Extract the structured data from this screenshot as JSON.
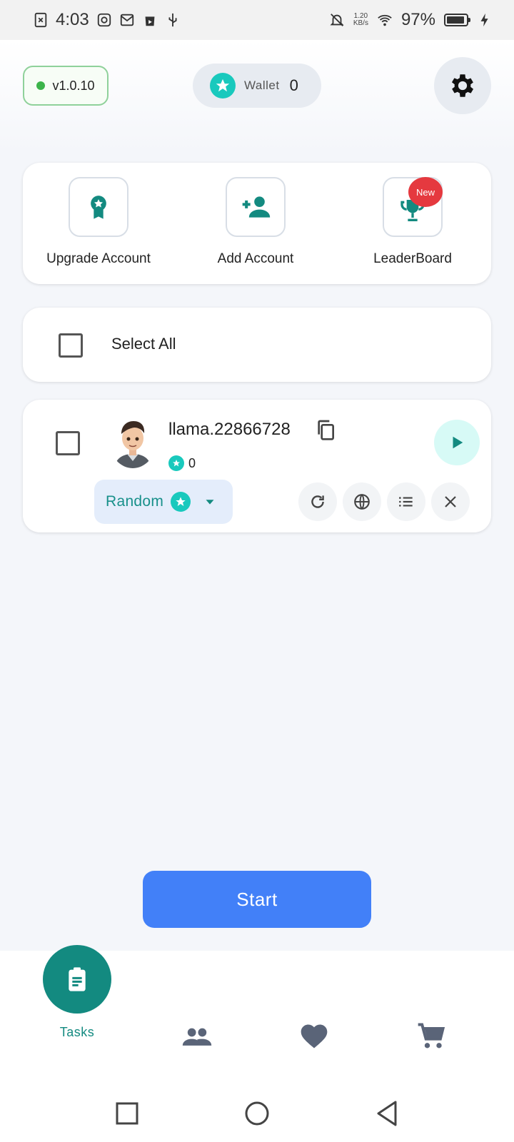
{
  "status_bar": {
    "time": "4:03",
    "net_speed_top": "1.20",
    "net_speed_bottom": "KB/s",
    "battery": "97%"
  },
  "header": {
    "version": "v1.0.10",
    "wallet_label": "Wallet",
    "wallet_value": "0"
  },
  "actions": {
    "upgrade_label": "Upgrade Account",
    "add_label": "Add Account",
    "leaderboard_label": "LeaderBoard",
    "leaderboard_badge": "New"
  },
  "select_all": {
    "label": "Select All"
  },
  "account": {
    "name": "llama.22866728",
    "coins": "0",
    "mode": "Random"
  },
  "start_label": "Start",
  "bottom_nav": {
    "tasks_label": "Tasks"
  },
  "colors": {
    "accent_teal": "#138a80",
    "start_blue": "#4280f8",
    "star_teal": "#19c9bd",
    "badge_red": "#e5393f"
  }
}
